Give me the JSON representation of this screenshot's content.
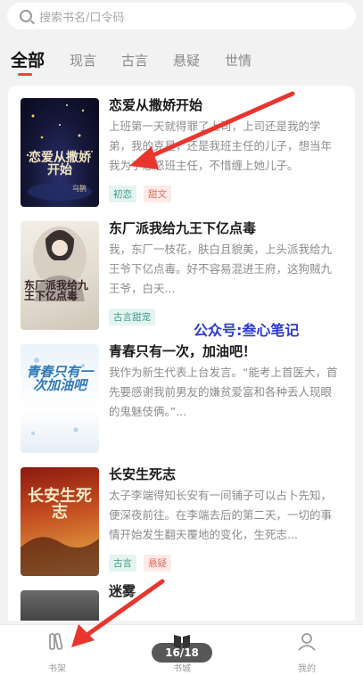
{
  "search": {
    "placeholder": "搜索书名/口令码"
  },
  "tabs": [
    {
      "label": "全部",
      "active": true
    },
    {
      "label": "现言",
      "active": false
    },
    {
      "label": "古言",
      "active": false
    },
    {
      "label": "悬疑",
      "active": false
    },
    {
      "label": "世情",
      "active": false
    }
  ],
  "books": [
    {
      "title": "恋爱从撒娇开始",
      "desc": "上班第一天就得罪了上司，上司还是我的学弟，我的克星，还是我班主任的儿子，想当年我为了惹怒班主任，不惜缠上她儿子。",
      "tags": [
        {
          "text": "初恋",
          "color": "green"
        },
        {
          "text": "甜文",
          "color": "red"
        }
      ],
      "cover_text": "恋爱从撒娇开始",
      "cover_author": "乌鹊"
    },
    {
      "title": "东厂派我给九王下亿点毒",
      "desc": "我，东厂一枝花，肤白且貌美，上头派我给九王爷下亿点毒。好不容易混进王府，这狗贼九王爷，白天...",
      "tags": [
        {
          "text": "古言甜宠",
          "color": "green"
        }
      ],
      "cover_text": "东厂派我给九王下亿点毒",
      "cover_author": ""
    },
    {
      "title": "青春只有一次，加油吧！",
      "desc": "我作为新生代表上台发言。“能考上首医大，首先要感谢我前男友的嫌贫爱富和各种丢人现眼的鬼魅伎俩。”...",
      "tags": [],
      "cover_text": "青春只有一次加油吧",
      "cover_author": ""
    },
    {
      "title": "长安生死志",
      "desc": "太子李端得知长安有一间铺子可以占卜先知，便深夜前往。在李端去后的第二天，一切的事情开始发生翻天覆地的变化，生死志...",
      "tags": [
        {
          "text": "古言",
          "color": "green"
        },
        {
          "text": "悬疑",
          "color": "red"
        }
      ],
      "cover_text": "长安生死志",
      "cover_author": ""
    }
  ],
  "partial_title": "迷雾",
  "watermark": "公众号:叁心笔记",
  "bottom_nav": [
    {
      "label": "书架",
      "icon": "bookshelf-icon"
    },
    {
      "label": "书城",
      "icon": "book-open-icon"
    },
    {
      "label": "我的",
      "icon": "profile-icon"
    }
  ],
  "page_indicator": "16/18",
  "colors": {
    "accent": "#e8453c",
    "tag_green": "#3a9a88",
    "tag_red": "#e36a5c",
    "annotation_arrow": "#e8362e"
  }
}
